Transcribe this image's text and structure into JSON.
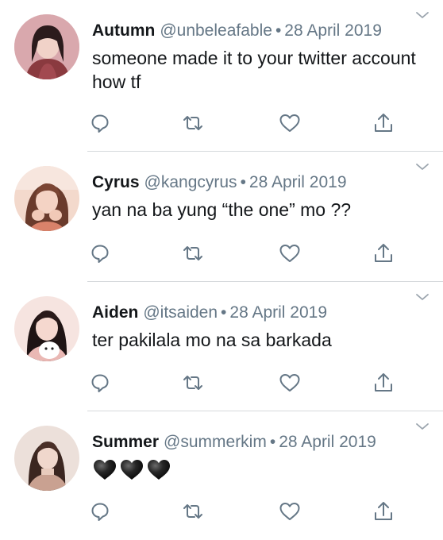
{
  "tweets": [
    {
      "name": "Autumn",
      "handle": "@unbeleafable",
      "separator": "•",
      "date": "28 April 2019",
      "text": "someone made it to your twitter account how tf",
      "avatar_colors": [
        "#c98a8f",
        "#2b1b1c",
        "#8a3a3f"
      ]
    },
    {
      "name": "Cyrus",
      "handle": "@kangcyrus",
      "separator": "•",
      "date": "28 April 2019",
      "text": "yan na ba yung “the one” mo ??",
      "avatar_colors": [
        "#e9b9a4",
        "#6a3b2c",
        "#d9826a"
      ]
    },
    {
      "name": "Aiden",
      "handle": "@itsaiden",
      "separator": "•",
      "date": "28 April 2019",
      "text": "ter pakilala mo na sa barkada",
      "avatar_colors": [
        "#f2d6d0",
        "#1f1414",
        "#ffffff"
      ]
    },
    {
      "name": "Summer",
      "handle": "@summerkim",
      "separator": "•",
      "date": "28 April 2019",
      "text": "",
      "emoji": [
        "black-heart",
        "black-heart",
        "black-heart"
      ],
      "avatar_colors": [
        "#e7d2c8",
        "#3b2620",
        "#c9a191"
      ]
    }
  ],
  "actions": [
    "reply-icon",
    "retweet-icon",
    "like-icon",
    "share-icon"
  ],
  "colors": {
    "icon": "#657786",
    "name": "#14171a",
    "meta": "#657786",
    "divider": "#d6d9dc"
  }
}
